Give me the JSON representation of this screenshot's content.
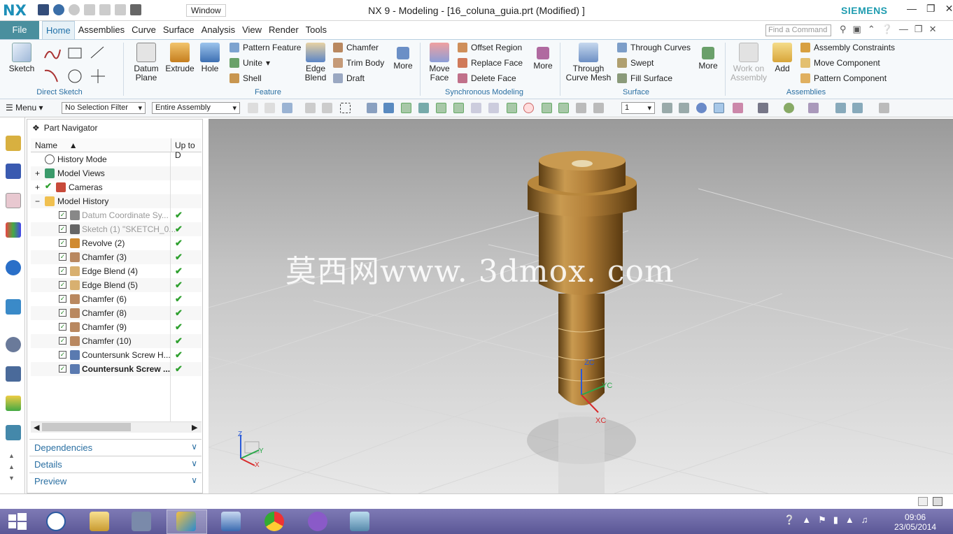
{
  "app": {
    "logo": "NX",
    "window_menu": "Window",
    "title": "NX 9 - Modeling - [16_coluna_guia.prt (Modified) ]",
    "brand": "SIEMENS"
  },
  "tabs": {
    "file": "File",
    "items": [
      "Home",
      "Assemblies",
      "Curve",
      "Surface",
      "Analysis",
      "View",
      "Render",
      "Tools"
    ],
    "active": "Home"
  },
  "search": {
    "placeholder": "Find a Command"
  },
  "ribbon": {
    "direct_sketch": {
      "sketch": "Sketch",
      "label": "Direct Sketch"
    },
    "feature": {
      "datum_plane": "Datum Plane",
      "extrude": "Extrude",
      "hole": "Hole",
      "pattern_feature": "Pattern Feature",
      "unite": "Unite",
      "shell": "Shell",
      "edge_blend": "Edge Blend",
      "chamfer": "Chamfer",
      "trim_body": "Trim Body",
      "draft": "Draft",
      "more": "More",
      "label": "Feature"
    },
    "synchronous": {
      "move_face": "Move Face",
      "offset_region": "Offset Region",
      "replace_face": "Replace Face",
      "delete_face": "Delete Face",
      "more": "More",
      "label": "Synchronous Modeling"
    },
    "surface": {
      "through_curve_mesh": "Through Curve Mesh",
      "through_curves": "Through Curves",
      "swept": "Swept",
      "fill_surface": "Fill Surface",
      "more": "More",
      "label": "Surface"
    },
    "assemblies": {
      "work_on_assembly": "Work on Assembly",
      "add": "Add",
      "assembly_constraints": "Assembly Constraints",
      "move_component": "Move Component",
      "pattern_component": "Pattern Component",
      "label": "Assemblies"
    }
  },
  "cmdbar": {
    "menu": "Menu",
    "selection_filter": "No Selection Filter",
    "scope": "Entire Assembly",
    "layer": "1"
  },
  "navigator": {
    "title": "Part Navigator",
    "col_name": "Name",
    "col_uptodate": "Up to D",
    "rows": [
      {
        "label": "History Mode",
        "level": 0
      },
      {
        "label": "Model Views",
        "level": 0
      },
      {
        "label": "Cameras",
        "level": 0
      },
      {
        "label": "Model History",
        "level": 0
      },
      {
        "label": "Datum Coordinate Sy...",
        "level": 1,
        "dim": true
      },
      {
        "label": "Sketch (1) \"SKETCH_0...",
        "level": 1,
        "dim": true
      },
      {
        "label": "Revolve (2)",
        "level": 1
      },
      {
        "label": "Chamfer (3)",
        "level": 1
      },
      {
        "label": "Edge Blend (4)",
        "level": 1
      },
      {
        "label": "Edge Blend (5)",
        "level": 1
      },
      {
        "label": "Chamfer (6)",
        "level": 1
      },
      {
        "label": "Chamfer (8)",
        "level": 1
      },
      {
        "label": "Chamfer (9)",
        "level": 1
      },
      {
        "label": "Chamfer (10)",
        "level": 1
      },
      {
        "label": "Countersunk Screw H...",
        "level": 1
      },
      {
        "label": "Countersunk Screw ...",
        "level": 1,
        "bold": true
      }
    ],
    "panels": [
      "Dependencies",
      "Details",
      "Preview"
    ]
  },
  "viewport": {
    "watermark": "莫西网www. 3dmox. com",
    "axis_zc": "ZC",
    "axis_yc": "YC",
    "axis_xc": "XC",
    "triad_z": "Z",
    "triad_y": "Y",
    "triad_x": "X"
  },
  "taskbar": {
    "time": "09:06",
    "date": "23/05/2014"
  }
}
